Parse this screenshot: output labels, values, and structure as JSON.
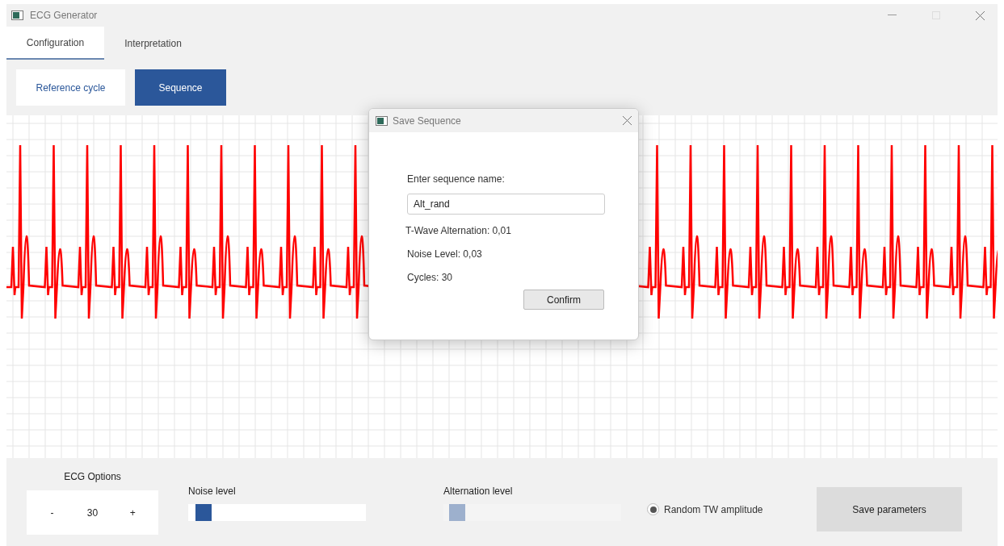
{
  "window": {
    "title": "ECG Generator"
  },
  "tabs": [
    {
      "label": "Configuration",
      "selected": true
    },
    {
      "label": "Interpretation",
      "selected": false
    }
  ],
  "modes": [
    {
      "label": "Reference cycle",
      "selected": false
    },
    {
      "label": "Sequence",
      "selected": true
    }
  ],
  "dialog": {
    "title": "Save Sequence",
    "prompt": "Enter sequence name:",
    "name_value": "Alt_rand",
    "lines": [
      "T-Wave Alternation: 0,01",
      "Noise Level: 0,03",
      "Cycles: 30"
    ],
    "confirm": "Confirm"
  },
  "options": {
    "title": "ECG Options",
    "minus": "-",
    "value": "30",
    "plus": "+"
  },
  "sliders": [
    {
      "label": "Noise level",
      "level": 0.03,
      "disabled": false
    },
    {
      "label": "Alternation level",
      "level": 0.02,
      "disabled": true
    }
  ],
  "radio": {
    "label": "Random TW amplitude",
    "selected": true
  },
  "save_button": "Save parameters"
}
